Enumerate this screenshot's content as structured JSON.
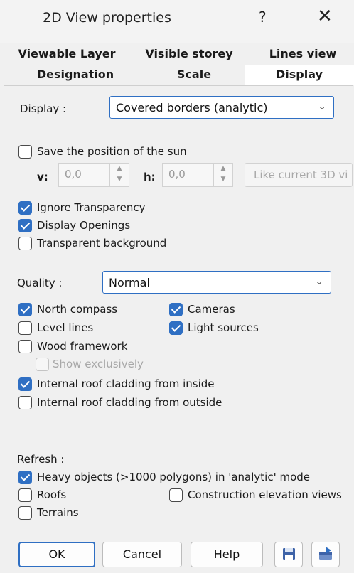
{
  "window": {
    "title": "2D View properties",
    "help": "?",
    "close": "✕"
  },
  "tabs": {
    "row1": [
      "Viewable Layer",
      "Visible storey",
      "Lines view"
    ],
    "row2": [
      "Designation",
      "Scale",
      "Display"
    ],
    "active": "Display"
  },
  "display": {
    "label": "Display :",
    "value": "Covered borders (analytic)"
  },
  "sun": {
    "save_label": "Save the position of the sun",
    "save_checked": false,
    "v_label": "v:",
    "v_value": "0,0",
    "h_label": "h:",
    "h_value": "0,0",
    "like_button": "Like current 3D vi"
  },
  "options": {
    "ignore_transparency": {
      "label": "Ignore Transparency",
      "checked": true
    },
    "display_openings": {
      "label": "Display Openings",
      "checked": true
    },
    "transparent_background": {
      "label": "Transparent background",
      "checked": false
    }
  },
  "quality": {
    "label": "Quality :",
    "value": "Normal"
  },
  "elements": {
    "north_compass": {
      "label": "North compass",
      "checked": true
    },
    "cameras": {
      "label": "Cameras",
      "checked": true
    },
    "level_lines": {
      "label": "Level lines",
      "checked": false
    },
    "light_sources": {
      "label": "Light sources",
      "checked": true
    },
    "wood_framework": {
      "label": "Wood framework",
      "checked": false
    },
    "show_exclusively": {
      "label": "Show exclusively",
      "checked": false
    },
    "roof_inside": {
      "label": "Internal roof cladding from inside",
      "checked": true
    },
    "roof_outside": {
      "label": "Internal roof cladding from outside",
      "checked": false
    }
  },
  "refresh": {
    "label": "Refresh :",
    "heavy_objects": {
      "label": "Heavy objects (>1000 polygons) in 'analytic' mode",
      "checked": true
    },
    "roofs": {
      "label": "Roofs",
      "checked": false
    },
    "construction_views": {
      "label": "Construction elevation views",
      "checked": false
    },
    "terrains": {
      "label": "Terrains",
      "checked": false
    }
  },
  "buttons": {
    "ok": "OK",
    "cancel": "Cancel",
    "help": "Help"
  },
  "icons": {
    "save": "save-icon",
    "export": "export-icon"
  },
  "colors": {
    "accent": "#2f6fc3",
    "background": "#f0f0f0"
  }
}
